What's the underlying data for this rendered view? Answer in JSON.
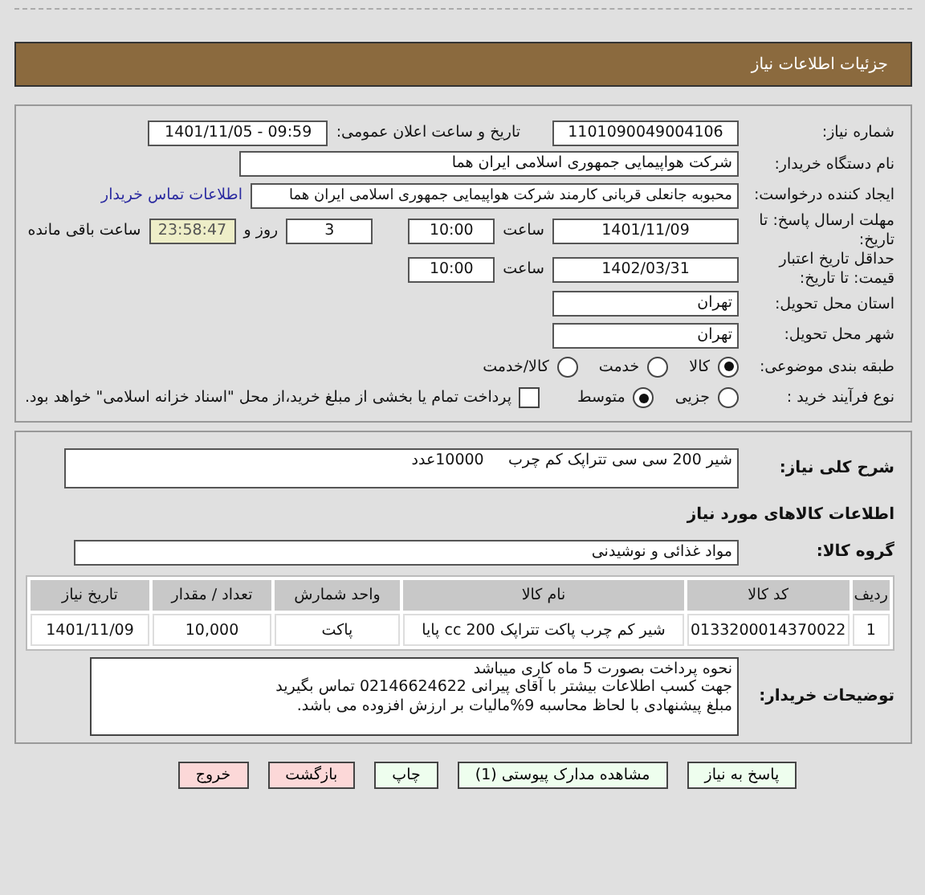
{
  "header": {
    "title": "جزئیات اطلاعات نیاز"
  },
  "need_number": {
    "label": "شماره نیاز:",
    "value": "1101090049004106"
  },
  "announce": {
    "label": "تاریخ و ساعت اعلان عمومی:",
    "value": "1401/11/05 - 09:59"
  },
  "buyer": {
    "label": "نام دستگاه خریدار:",
    "value": "شرکت هواپیمایی جمهوری اسلامی ایران هما"
  },
  "creator": {
    "label": "ایجاد کننده درخواست:",
    "value": "محبوبه جانعلی قربانی کارمند شرکت هواپیمایی جمهوری اسلامی ایران هما",
    "link": "اطلاعات تماس خریدار"
  },
  "deadline": {
    "label": "مهلت ارسال پاسخ: تا تاریخ:",
    "date": "1401/11/09",
    "time_label": "ساعت",
    "time": "10:00",
    "days": "3",
    "days_label": "روز و",
    "remaining": "23:58:47",
    "remaining_label": "ساعت باقی مانده"
  },
  "validity": {
    "label": "حداقل تاریخ اعتبار قیمت: تا تاریخ:",
    "date": "1402/03/31",
    "time_label": "ساعت",
    "time": "10:00"
  },
  "province": {
    "label": "استان محل تحویل:",
    "value": "تهران"
  },
  "city": {
    "label": "شهر محل تحویل:",
    "value": "تهران"
  },
  "category": {
    "label": "طبقه بندی موضوعی:",
    "options": [
      {
        "label": "کالا",
        "selected": true
      },
      {
        "label": "خدمت",
        "selected": false
      },
      {
        "label": "کالا/خدمت",
        "selected": false
      }
    ]
  },
  "purchase_type": {
    "label": "نوع فرآیند خرید :",
    "options": [
      {
        "label": "جزیی",
        "selected": false
      },
      {
        "label": "متوسط",
        "selected": true
      }
    ],
    "treasury": {
      "checked": false,
      "text": "پرداخت تمام یا بخشی از مبلغ خرید،از محل \"اسناد خزانه اسلامی\" خواهد بود."
    }
  },
  "summary": {
    "label": "شرح کلی نیاز:",
    "value": "شیر 200 سی سی تتراپک کم چرب     10000عدد"
  },
  "items_heading": "اطلاعات کالاهای مورد نیاز",
  "group": {
    "label": "گروه کالا:",
    "value": "مواد غذائی و نوشیدنی"
  },
  "table": {
    "columns": [
      "ردیف",
      "کد کالا",
      "نام کالا",
      "واحد شمارش",
      "تعداد / مقدار",
      "تاریخ نیاز"
    ],
    "rows": [
      [
        "1",
        "0133200014370022",
        "شیر کم چرب پاکت تتراپک 200 cc پایا",
        "پاکت",
        "10,000",
        "1401/11/09"
      ]
    ]
  },
  "notes": {
    "label": "توضیحات خریدار:",
    "lines": [
      "نحوه پرداخت بصورت 5 ماه کاری میباشد",
      "جهت کسب اطلاعات بیشتر با آقای پیرانی 02146624622 تماس بگیرید",
      "مبلغ پیشنهادی با لحاظ محاسبه 9%مالیات بر ارزش افزوده می باشد."
    ]
  },
  "buttons": [
    {
      "label": "پاسخ به نیاز",
      "kind": "normal"
    },
    {
      "label": "مشاهده مدارک پیوستی (1)",
      "kind": "normal"
    },
    {
      "label": "چاپ",
      "kind": "normal"
    },
    {
      "label": "بازگشت",
      "kind": "danger"
    },
    {
      "label": "خروج",
      "kind": "danger"
    }
  ]
}
